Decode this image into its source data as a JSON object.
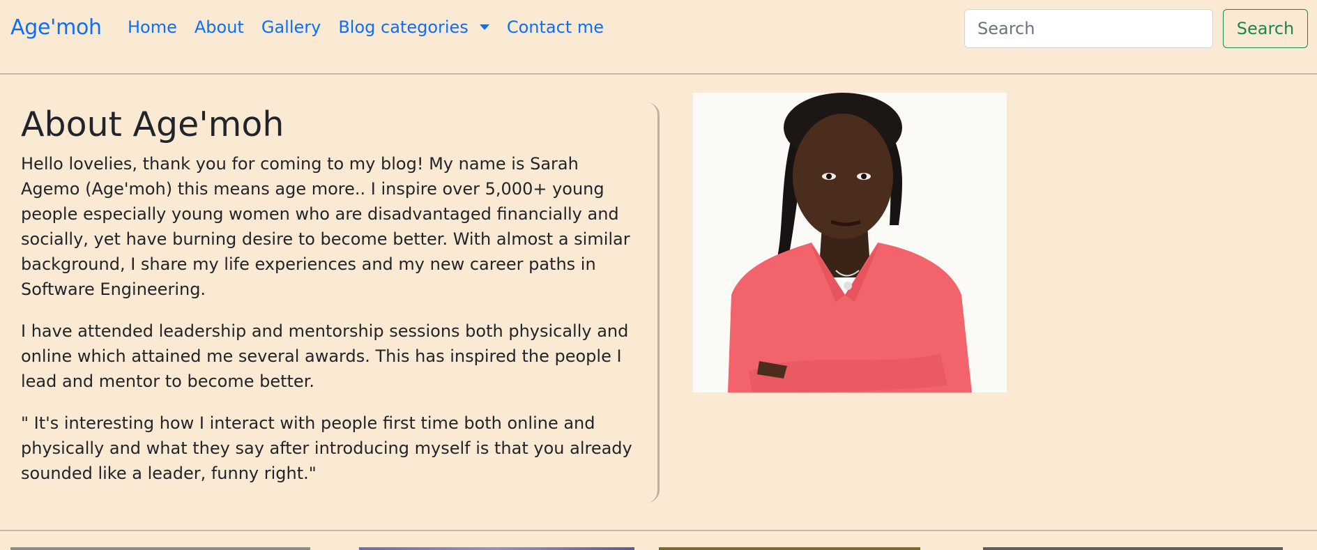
{
  "navbar": {
    "brand": "Age'moh",
    "links": [
      {
        "label": "Home"
      },
      {
        "label": "About"
      },
      {
        "label": "Gallery"
      },
      {
        "label": "Blog categories"
      },
      {
        "label": "Contact me"
      }
    ],
    "search": {
      "placeholder": "Search",
      "value": "",
      "button_label": "Search"
    }
  },
  "about": {
    "title": "About Age'moh",
    "paragraphs": [
      "Hello lovelies, thank you for coming to my blog! My name is Sarah Agemo (Age'moh) this means age more.. I inspire over 5,000+ young people especially young women who are disadvantaged financially and socially, yet have burning desire to become better. With almost a similar background, I share my life experiences and my new career paths in Software Engineering.",
      "I have attended leadership and mentorship sessions both physically and online which attained me several awards. This has inspired the people I lead and mentor to become better.",
      "\" It's interesting how I interact with people first time both online and physically and what they say after introducing myself is that you already sounded like a leader, funny right.\""
    ]
  },
  "colors": {
    "background": "#fae9d3",
    "link": "#0d6efd",
    "success": "#198754",
    "text": "#212529",
    "shirt": "#f2636b"
  },
  "icons": {
    "dropdown": "caret-down-icon"
  }
}
